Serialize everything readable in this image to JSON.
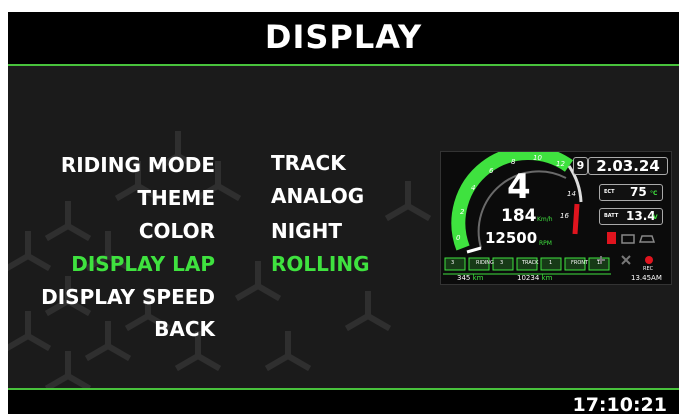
{
  "header": {
    "title": "DISPLAY"
  },
  "menu": [
    {
      "label": "RIDING MODE",
      "value": "TRACK",
      "active": false
    },
    {
      "label": "THEME",
      "value": "ANALOG",
      "active": false
    },
    {
      "label": "COLOR",
      "value": "NIGHT",
      "active": false
    },
    {
      "label": "DISPLAY LAP",
      "value": "ROLLING",
      "active": true
    },
    {
      "label": "DISPLAY SPEED",
      "value": "",
      "active": false
    },
    {
      "label": "BACK",
      "value": "",
      "active": false
    }
  ],
  "preview": {
    "gauge_ticks": [
      "2",
      "4",
      "6",
      "8",
      "10",
      "12",
      "14",
      "16",
      "0"
    ],
    "gear": "4",
    "speed": "184",
    "speed_unit": "Km/h",
    "rpm": "12500",
    "rpm_unit": "RPM",
    "lap_number": "9",
    "lap_time": "2.03.24",
    "ect_label": "ECT",
    "ect_value": "75",
    "ect_unit": "°C",
    "batt_label": "BATT",
    "batt_value": "13.4",
    "batt_unit": "V",
    "mode_values": [
      "3",
      "3",
      "1",
      "1"
    ],
    "mode_labels": [
      "RIDING",
      "TRACK",
      "FRONT"
    ],
    "odo_trip": "345",
    "odo_trip_unit": "km",
    "odo_total": "10234",
    "odo_total_unit": "km",
    "time": "13.45AM",
    "rec_label": "REC",
    "accent_color": "#3fe23f",
    "warning_color": "#e0141e"
  },
  "footer": {
    "clock": "17:10:21"
  },
  "colors": {
    "accent": "#48c23c",
    "active_text": "#3fe23f",
    "background": "#1b1b1b"
  }
}
